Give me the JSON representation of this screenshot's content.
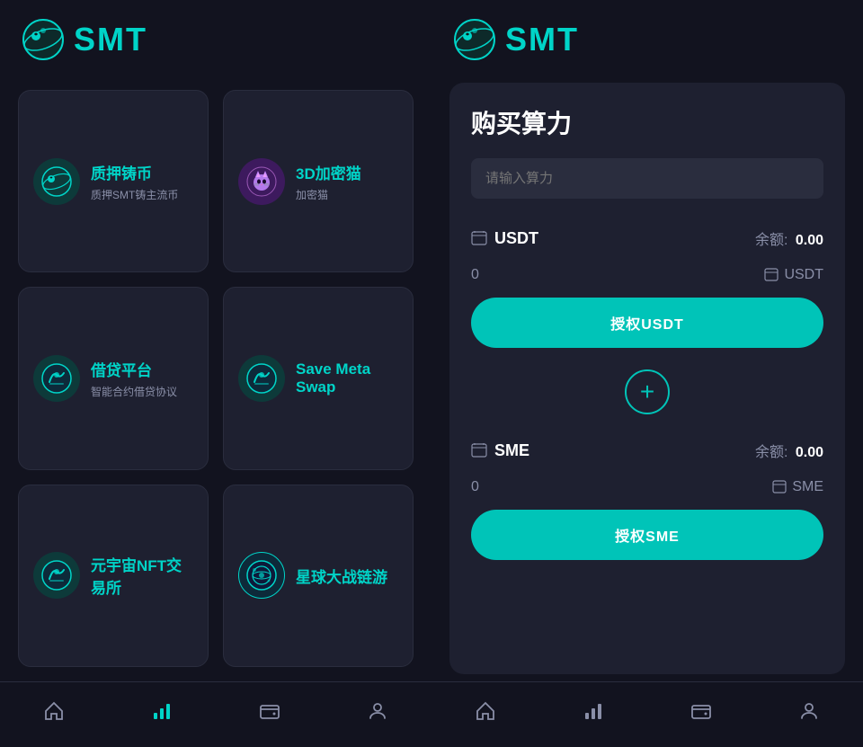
{
  "left": {
    "header_title": "SMT",
    "grid_items": [
      {
        "id": "pledge",
        "title": "质押铸币",
        "subtitle": "质押SMT铸主流币",
        "icon_type": "smt_teal"
      },
      {
        "id": "cat3d",
        "title": "3D加密猫",
        "subtitle": "加密猫",
        "icon_type": "cat_purple"
      },
      {
        "id": "lending",
        "title": "借贷平台",
        "subtitle": "智能合约借贷协议",
        "icon_type": "smt_blue"
      },
      {
        "id": "savemeta",
        "title": "Save Meta Swap",
        "subtitle": "",
        "icon_type": "smt_blue2"
      },
      {
        "id": "nft",
        "title": "元宇宙NFT交易所",
        "subtitle": "",
        "icon_type": "smt_blue3"
      },
      {
        "id": "battle",
        "title": "星球大战链游",
        "subtitle": "",
        "icon_type": "planet"
      }
    ],
    "nav": {
      "home_label": "home",
      "chart_label": "chart",
      "wallet_label": "wallet",
      "user_label": "user"
    }
  },
  "right": {
    "header_title": "SMT",
    "modal": {
      "title": "购买算力",
      "input_placeholder": "请输入算力",
      "usdt_token": "USDT",
      "usdt_balance_label": "余额:",
      "usdt_balance": "0.00",
      "usdt_amount": "0",
      "sme_token": "SME",
      "sme_balance_label": "余额:",
      "sme_balance": "0.00",
      "sme_amount": "0",
      "auth_usdt_btn": "授权USDT",
      "auth_sme_btn": "授权SME",
      "plus_icon": "+"
    },
    "nav": {
      "home_label": "home",
      "chart_label": "chart",
      "wallet_label": "wallet",
      "user_label": "user"
    }
  }
}
